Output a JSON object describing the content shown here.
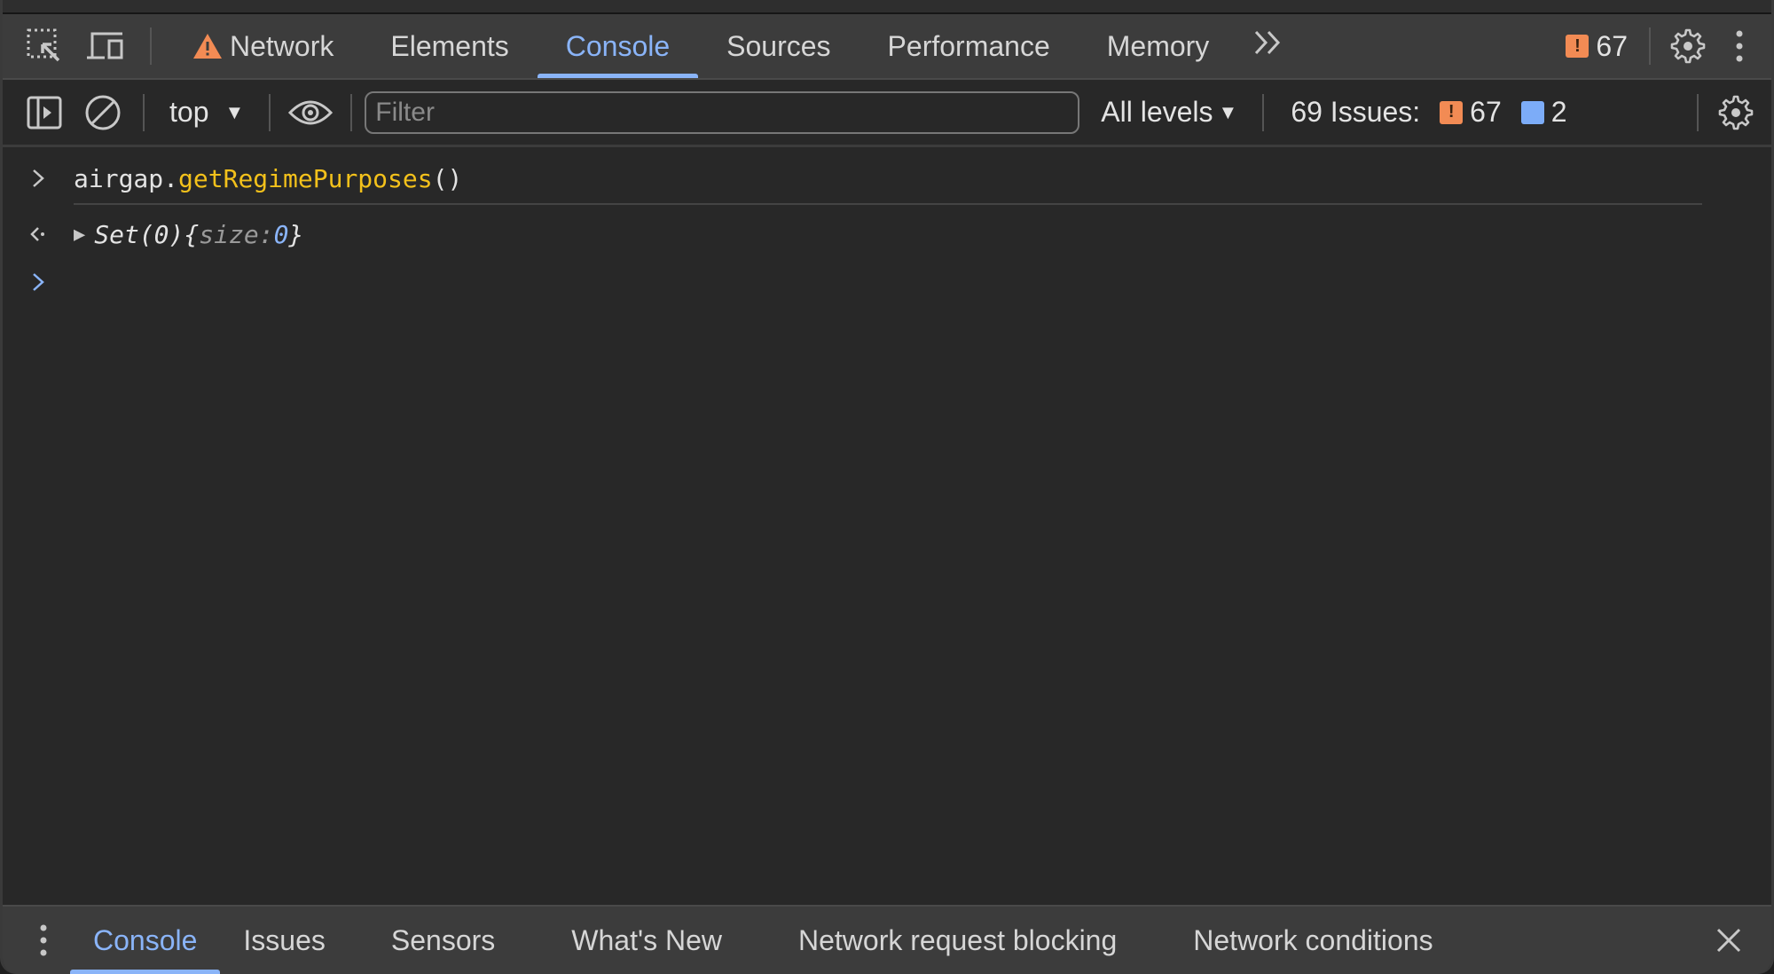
{
  "tabbar": {
    "inspect_icon": "inspect-element-icon",
    "device_icon": "device-toolbar-icon",
    "tabs": [
      {
        "label": "Network",
        "warning": true
      },
      {
        "label": "Elements"
      },
      {
        "label": "Console",
        "active": true
      },
      {
        "label": "Sources"
      },
      {
        "label": "Performance"
      },
      {
        "label": "Memory"
      }
    ],
    "more_tabs_glyph": "»",
    "issues_badge_count": "67",
    "settings_icon": "gear-icon",
    "menu_icon": "kebab-menu-icon"
  },
  "toolbar": {
    "context": "top",
    "filter_placeholder": "Filter",
    "filter_value": "",
    "levels": "All levels",
    "issues_label": "69 Issues:",
    "issues_warnings": "67",
    "issues_info": "2"
  },
  "console": {
    "command": {
      "object": "airgap.",
      "method": "getRegimePurposes",
      "args": "()"
    },
    "result": {
      "type": "Set(0)",
      "open_brace": " {",
      "key": "size: ",
      "value": "0",
      "close_brace": "}"
    }
  },
  "drawer": {
    "tabs": [
      {
        "label": "Console",
        "active": true
      },
      {
        "label": "Issues"
      },
      {
        "label": "Sensors"
      },
      {
        "label": "What's New"
      },
      {
        "label": "Network request blocking"
      },
      {
        "label": "Network conditions"
      }
    ],
    "close_glyph": "✕"
  },
  "colors": {
    "accent": "#8ab4f8",
    "warning": "#f28b54",
    "function": "#f3c11b",
    "background": "#282828"
  }
}
